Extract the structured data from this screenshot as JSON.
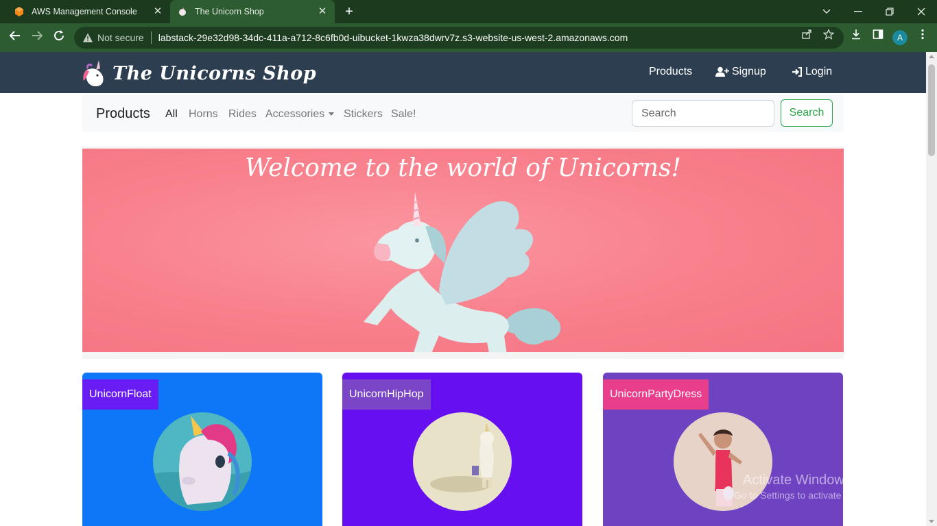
{
  "browser": {
    "tabs": [
      {
        "title": "AWS Management Console",
        "close": "✕"
      },
      {
        "title": "The Unicorn Shop",
        "close": "✕"
      }
    ],
    "new_tab": "+",
    "security_label": "Not secure",
    "url": "labstack-29e32d98-34dc-411a-a712-8c6fb0d-uibucket-1kwza38dwrv7z.s3-website-us-west-2.amazonaws.com",
    "profile_initial": "A",
    "colors": {
      "tab_strip": "#1b3a1e",
      "toolbar": "#2c5c2f"
    }
  },
  "site": {
    "logo_text": "The Unicorns Shop",
    "nav": [
      {
        "label": "Products",
        "icon": "none"
      },
      {
        "label": "Signup",
        "icon": "user-plus-icon"
      },
      {
        "label": "Login",
        "icon": "sign-in-icon"
      }
    ],
    "colors": {
      "navbar": "#2c3e50",
      "success": "#28a745"
    }
  },
  "subnav": {
    "brand": "Products",
    "categories": [
      "All",
      "Horns",
      "Rides",
      "Accessories",
      "Stickers",
      "Sale!"
    ],
    "active_category": "All",
    "search_placeholder": "Search",
    "search_button": "Search"
  },
  "hero": {
    "title": "Welcome to the world of Unicorns!",
    "color": "#f87f8b"
  },
  "products": [
    {
      "name": "UnicornFloat",
      "card_color": "#0d77f7",
      "badge_color": "#6a1cf5"
    },
    {
      "name": "UnicornHipHop",
      "card_color": "#6610f2",
      "badge_color": "#7a45c6"
    },
    {
      "name": "UnicornPartyDress",
      "card_color": "#6f42c1",
      "badge_color": "#e83e8c"
    }
  ],
  "os_watermark": {
    "line1": "Activate Windows",
    "line2": "Go to Settings to activate Windows."
  }
}
